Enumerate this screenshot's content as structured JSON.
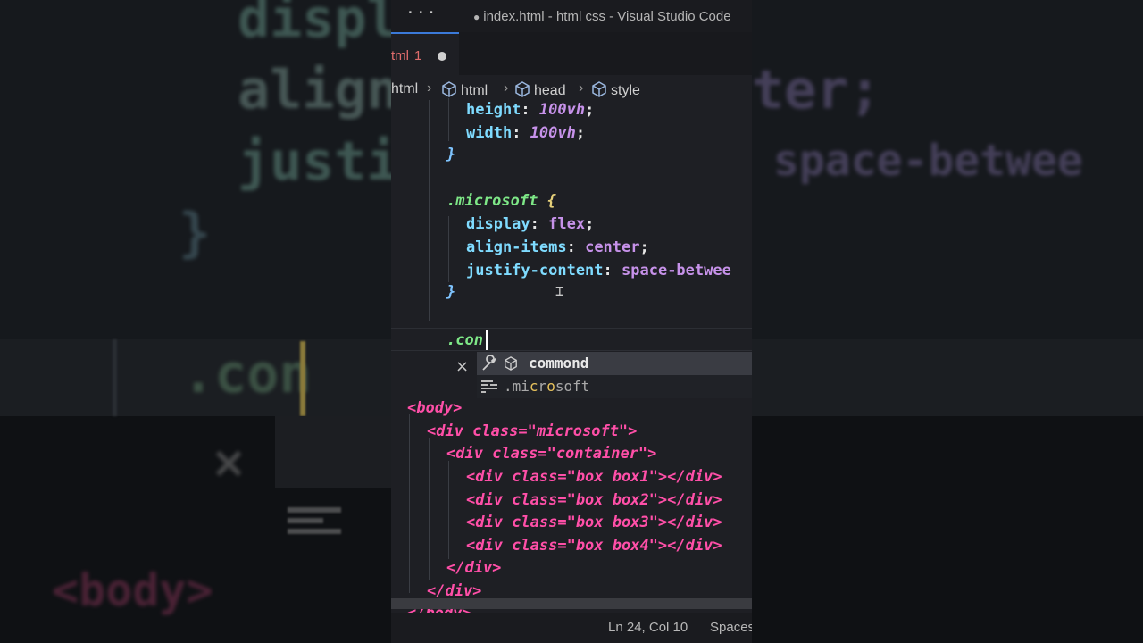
{
  "window": {
    "title": "index.html - html css - Visual Studio Code",
    "modified_dot": "●",
    "more": "···"
  },
  "tab": {
    "label": "tml",
    "problems": "1"
  },
  "breadcrumb": [
    "html",
    "html",
    "head",
    "style"
  ],
  "code": {
    "l1_prop": "height",
    "l1_val": "100vh",
    "l2_prop": "width",
    "l2_val": "100vh",
    "l3": "}",
    "l5_sel": ".microsoft",
    "l5_brace": "{",
    "l6_prop": "display",
    "l6_val": "flex",
    "l7_prop": "align-items",
    "l7_val": "center",
    "l8_prop": "justify-content",
    "l8_val": "space-betwee",
    "l9": "}",
    "l11_typed": ".con"
  },
  "suggest": {
    "items": [
      {
        "label": "commond",
        "kind": "property"
      },
      {
        "label": ".microsoft",
        "kind": "text"
      }
    ],
    "close": "×"
  },
  "html_code": {
    "body": "<body>",
    "div_ms_open": "<div class=\"microsoft\">",
    "div_container_open": "<div class=\"container\">",
    "box1": "<div class=\"box box1\"></div>",
    "box2": "<div class=\"box box2\"></div>",
    "box3": "<div class=\"box box3\"></div>",
    "box4": "<div class=\"box box4\"></div>",
    "div_close_1": "</div>",
    "div_close_2": "</div>",
    "body_close": "</body>"
  },
  "status": {
    "position": "Ln 24, Col 10",
    "indent": "Spaces"
  },
  "background": {
    "t1": "displ",
    "t2": "align",
    "t3": "justi",
    "t4": "}",
    "t5": ".con",
    "t6": "ter;",
    "t7": "space-betwee",
    "t8": "<body>",
    "t9": "×"
  },
  "colors": {
    "editor_bg": "#1e1f24",
    "accent": "#3b7ad9",
    "tag": "#ff4fa8",
    "property": "#7fdbff",
    "value": "#c792ea",
    "selector": "#7ee787"
  }
}
